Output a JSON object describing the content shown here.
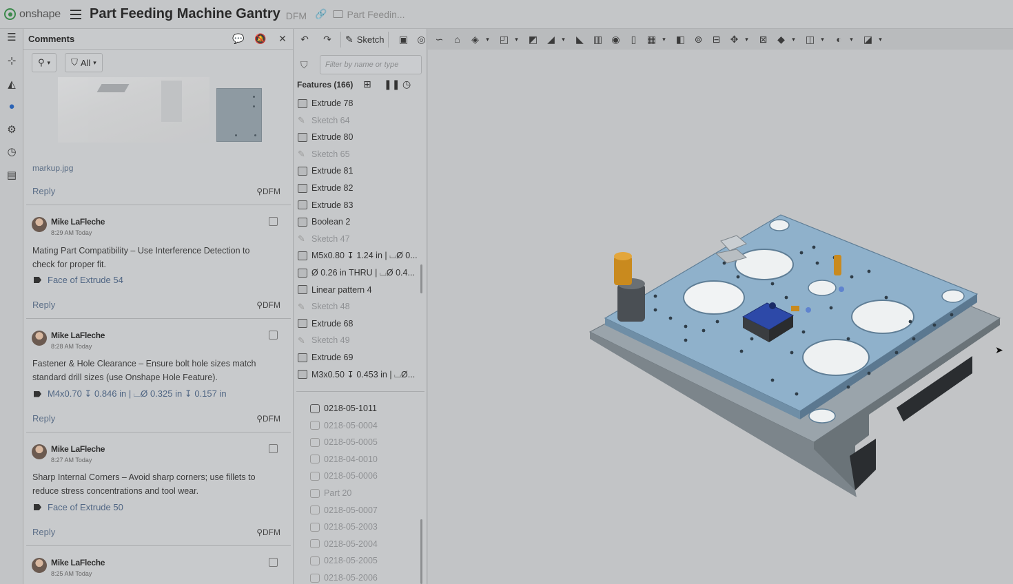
{
  "app": {
    "logo_text": "onshape"
  },
  "document": {
    "title": "Part Feeding Machine Gantry",
    "badge": "DFM",
    "folder": "Part Feedin..."
  },
  "comments_panel": {
    "title": "Comments",
    "filter_label": "All",
    "attachment_name": "markup.jpg",
    "first_reply": {
      "reply": "Reply",
      "tag": "DFM"
    },
    "comments": [
      {
        "author": "Mike LaFleche",
        "time": "8:29 AM Today",
        "line1": "Mating Part Compatibility – Use Interference Detection to",
        "line2": "check for proper fit.",
        "ref": "Face of Extrude 54",
        "reply": "Reply",
        "tag": "DFM"
      },
      {
        "author": "Mike LaFleche",
        "time": "8:28 AM Today",
        "line1": "Fastener & Hole Clearance – Ensure bolt hole sizes match",
        "line2": "standard drill sizes (use Onshape Hole Feature).",
        "ref": "M4x0.70 ↧ 0.846 in | ⌴Ø 0.325 in ↧ 0.157 in",
        "reply": "Reply",
        "tag": "DFM"
      },
      {
        "author": "Mike LaFleche",
        "time": "8:27 AM Today",
        "line1": "Sharp Internal Corners – Avoid sharp corners; use fillets to",
        "line2": "reduce stress concentrations and tool wear.",
        "ref": "Face of Extrude 50",
        "reply": "Reply",
        "tag": "DFM"
      },
      {
        "author": "Mike LaFleche",
        "time": "8:25 AM Today"
      }
    ]
  },
  "feature_tree": {
    "filter_placeholder": "Filter by name or type",
    "header": "Features (166)",
    "features": [
      {
        "label": "Extrude 78",
        "kind": "extrude"
      },
      {
        "label": "Sketch 64",
        "kind": "sketch"
      },
      {
        "label": "Extrude 80",
        "kind": "extrude"
      },
      {
        "label": "Sketch 65",
        "kind": "sketch"
      },
      {
        "label": "Extrude 81",
        "kind": "extrude"
      },
      {
        "label": "Extrude 82",
        "kind": "extrude"
      },
      {
        "label": "Extrude 83",
        "kind": "extrude"
      },
      {
        "label": "Boolean 2",
        "kind": "boolean"
      },
      {
        "label": "Sketch 47",
        "kind": "sketch"
      },
      {
        "label": "M5x0.80 ↧ 1.24 in | ⌴Ø 0...",
        "kind": "hole"
      },
      {
        "label": "Ø 0.26 in THRU | ⌴Ø 0.4...",
        "kind": "hole"
      },
      {
        "label": "Linear pattern 4",
        "kind": "pattern"
      },
      {
        "label": "Sketch 48",
        "kind": "sketch"
      },
      {
        "label": "Extrude 68",
        "kind": "extrude"
      },
      {
        "label": "Sketch 49",
        "kind": "sketch"
      },
      {
        "label": "Extrude 69",
        "kind": "extrude"
      },
      {
        "label": "M3x0.50 ↧ 0.453 in | ⌴Ø...",
        "kind": "hole"
      }
    ],
    "parts": [
      {
        "label": "0218-05-1011",
        "dim": false
      },
      {
        "label": "0218-05-0004",
        "dim": true
      },
      {
        "label": "0218-05-0005",
        "dim": true
      },
      {
        "label": "0218-04-0010",
        "dim": true
      },
      {
        "label": "0218-05-0006",
        "dim": true
      },
      {
        "label": "Part 20",
        "dim": true
      },
      {
        "label": "0218-05-0007",
        "dim": true
      },
      {
        "label": "0218-05-2003",
        "dim": true
      },
      {
        "label": "0218-05-2004",
        "dim": true
      },
      {
        "label": "0218-05-2005",
        "dim": true
      },
      {
        "label": "0218-05-2006",
        "dim": true
      }
    ]
  },
  "toolbar": {
    "sketch_label": "Sketch"
  },
  "colors": {
    "accent": "#2b63b5",
    "plate": "#8fb1cb",
    "pin": "#c98a1e",
    "block": "#2d49a8"
  }
}
